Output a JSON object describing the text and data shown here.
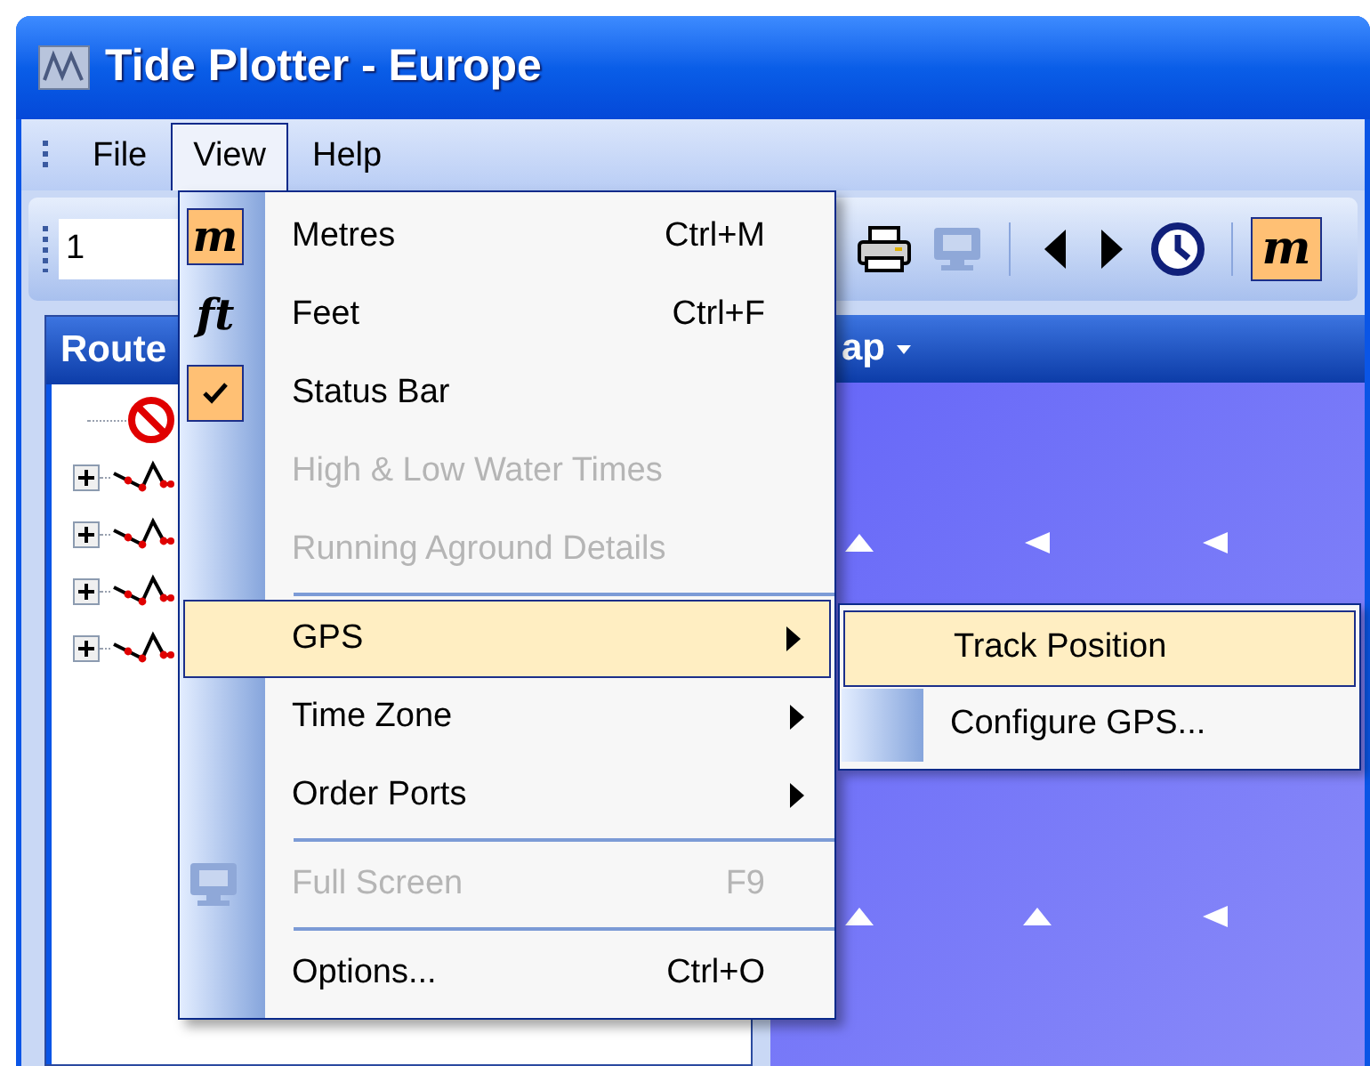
{
  "window": {
    "title": "Tide Plotter - Europe"
  },
  "menubar": [
    {
      "label": "File",
      "selected": false
    },
    {
      "label": "View",
      "selected": true
    },
    {
      "label": "Help",
      "selected": false
    }
  ],
  "toolbar": {
    "field_value": "1",
    "items": [
      {
        "kind": "print",
        "disabled": false
      },
      {
        "kind": "monitor",
        "disabled": true
      },
      {
        "kind": "separator"
      },
      {
        "kind": "back",
        "disabled": false
      },
      {
        "kind": "forward",
        "disabled": false
      },
      {
        "kind": "clock",
        "disabled": false
      },
      {
        "kind": "separator"
      },
      {
        "kind": "units",
        "text": "m",
        "checked": true
      }
    ]
  },
  "left_panel": {
    "title": "Route",
    "tree": [
      {
        "kind": "stop"
      },
      {
        "kind": "route",
        "expanded": false
      },
      {
        "kind": "route",
        "expanded": false
      },
      {
        "kind": "route",
        "expanded": false
      },
      {
        "kind": "route",
        "expanded": false
      }
    ]
  },
  "right_panel": {
    "title": "ap"
  },
  "view_menu": {
    "items": [
      {
        "kind": "item",
        "icon_text": "m",
        "label": "Metres",
        "shortcut": "Ctrl+M",
        "checked": true,
        "disabled": false,
        "selected": false
      },
      {
        "kind": "item",
        "icon_text": "ft",
        "label": "Feet",
        "shortcut": "Ctrl+F",
        "checked": false,
        "disabled": false,
        "selected": false
      },
      {
        "kind": "item",
        "label": "Status Bar",
        "checked": true,
        "disabled": false,
        "selected": false
      },
      {
        "kind": "item",
        "label": "High & Low Water Times",
        "checked": false,
        "disabled": true,
        "selected": false
      },
      {
        "kind": "item",
        "label": "Running Aground Details",
        "checked": false,
        "disabled": true,
        "selected": false
      },
      {
        "kind": "separator"
      },
      {
        "kind": "submenu",
        "label": "GPS",
        "disabled": false,
        "selected": true
      },
      {
        "kind": "submenu",
        "label": "Time Zone",
        "disabled": false,
        "selected": false
      },
      {
        "kind": "submenu",
        "label": "Order Ports",
        "disabled": false,
        "selected": false
      },
      {
        "kind": "separator"
      },
      {
        "kind": "screen_item",
        "label": "Full Screen",
        "shortcut": "F9",
        "disabled": true,
        "selected": false
      },
      {
        "kind": "separator"
      },
      {
        "kind": "item",
        "label": "Options...",
        "shortcut": "Ctrl+O",
        "checked": false,
        "disabled": false,
        "selected": false
      }
    ]
  },
  "gps_submenu": {
    "items": [
      {
        "label": "Track Position",
        "selected": true
      },
      {
        "label": "Configure GPS...",
        "selected": false
      }
    ]
  }
}
